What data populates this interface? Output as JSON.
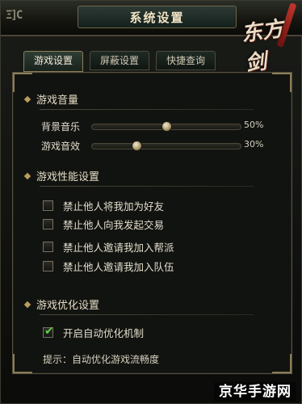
{
  "window": {
    "title": "系统设置",
    "corner_label": "Ξ]C",
    "logo_text": "东方剑"
  },
  "tabs": [
    {
      "label": "游戏设置",
      "active": true
    },
    {
      "label": "屏蔽设置",
      "active": false
    },
    {
      "label": "快捷查询",
      "active": false
    }
  ],
  "volume": {
    "title": "游戏音量",
    "sliders": [
      {
        "label": "背景音乐",
        "value_text": "50%",
        "level": 0.5
      },
      {
        "label": "游戏音效",
        "value_text": "30%",
        "level": 0.3
      }
    ]
  },
  "performance": {
    "title": "游戏性能设置",
    "options": [
      {
        "label": "禁止他人将我加为好友",
        "checked": false
      },
      {
        "label": "禁止他人向我发起交易",
        "checked": false
      },
      {
        "label": "禁止他人邀请我加入帮派",
        "checked": false
      },
      {
        "label": "禁止他人邀请我加入队伍",
        "checked": false
      }
    ]
  },
  "optimization": {
    "title": "游戏优化设置",
    "option": {
      "label": "开启自动优化机制",
      "checked": true
    },
    "hint": "提示：自动优化游戏流畅度"
  },
  "watermark": "京华手游网",
  "colors": {
    "accent": "#b89d5c",
    "check": "#5fd04a"
  }
}
